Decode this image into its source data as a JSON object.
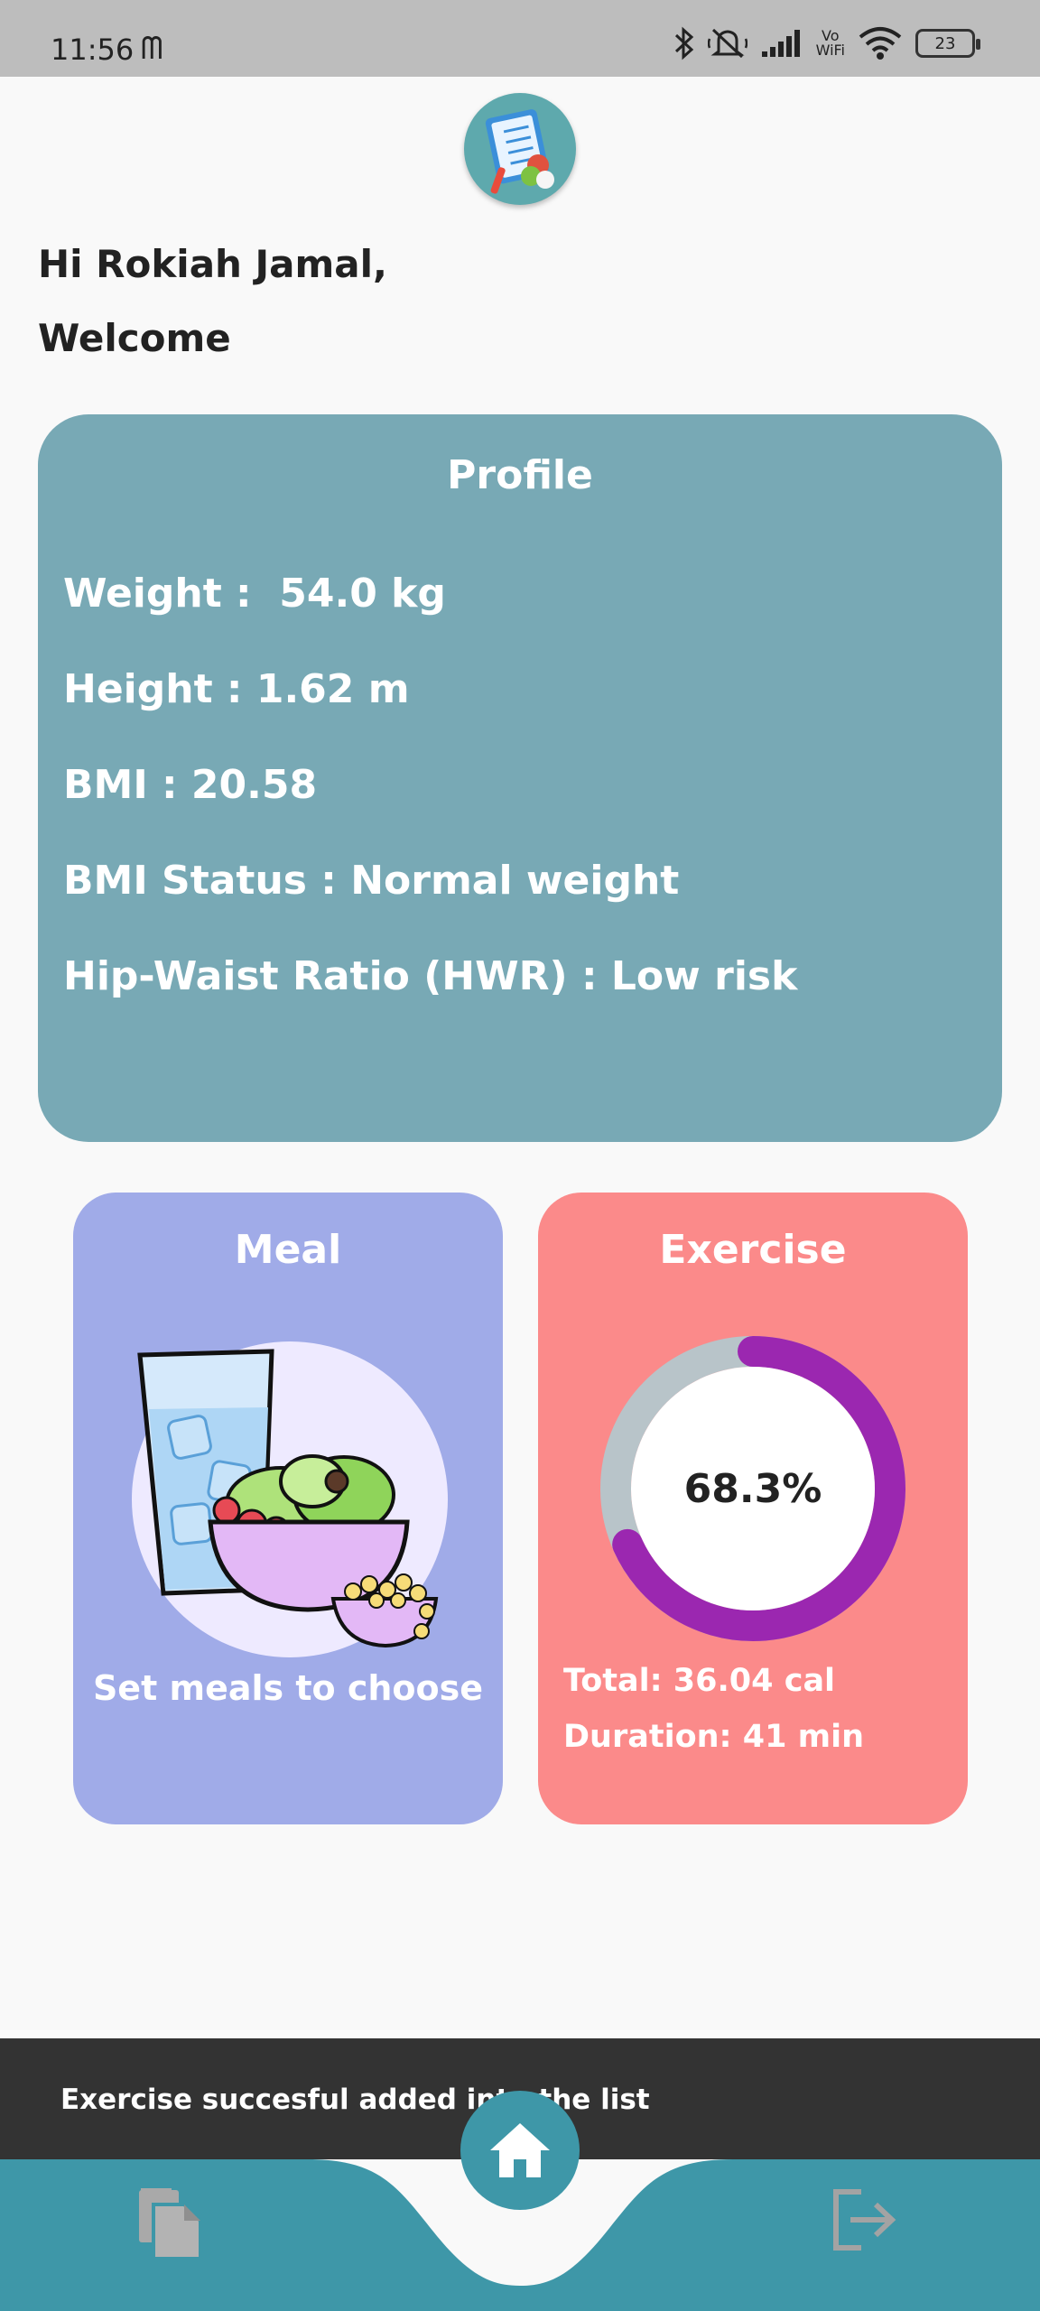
{
  "status_bar": {
    "time": "11:56",
    "carrier_icon": "mcdonalds-m",
    "vowifi": "Vo\nWiFi",
    "battery": "23",
    "icons": [
      "bluetooth-icon",
      "mute-icon",
      "signal-icon",
      "vowifi-icon",
      "wifi-icon",
      "battery-icon"
    ]
  },
  "header": {
    "greeting": "Hi Rokiah Jamal,",
    "welcome": "Welcome"
  },
  "profile": {
    "title": "Profile",
    "weight": "Weight :  54.0 kg",
    "height": "Height : 1.62 m",
    "bmi": "BMI : 20.58",
    "bmi_status": "BMI Status : Normal weight",
    "hwr": "Hip-Waist Ratio (HWR) : Low risk",
    "color": "#78a9b5"
  },
  "meal": {
    "title": "Meal",
    "caption": "Set meals to choose",
    "color": "#a0abe8"
  },
  "exercise": {
    "title": "Exercise",
    "progress_percent": 68.3,
    "progress_label": "68.3%",
    "total": "Total: 36.04 cal",
    "duration": "Duration: 41 min",
    "color": "#fb8a8a",
    "ring_color": "#9b27b0",
    "ring_track_color": "#b8c4c9"
  },
  "snackbar": {
    "message": "Exercise succesful added into the list"
  },
  "bottom_nav": {
    "color": "#3e97a8",
    "items": [
      "documents-icon",
      "home-icon",
      "logout-icon"
    ]
  }
}
